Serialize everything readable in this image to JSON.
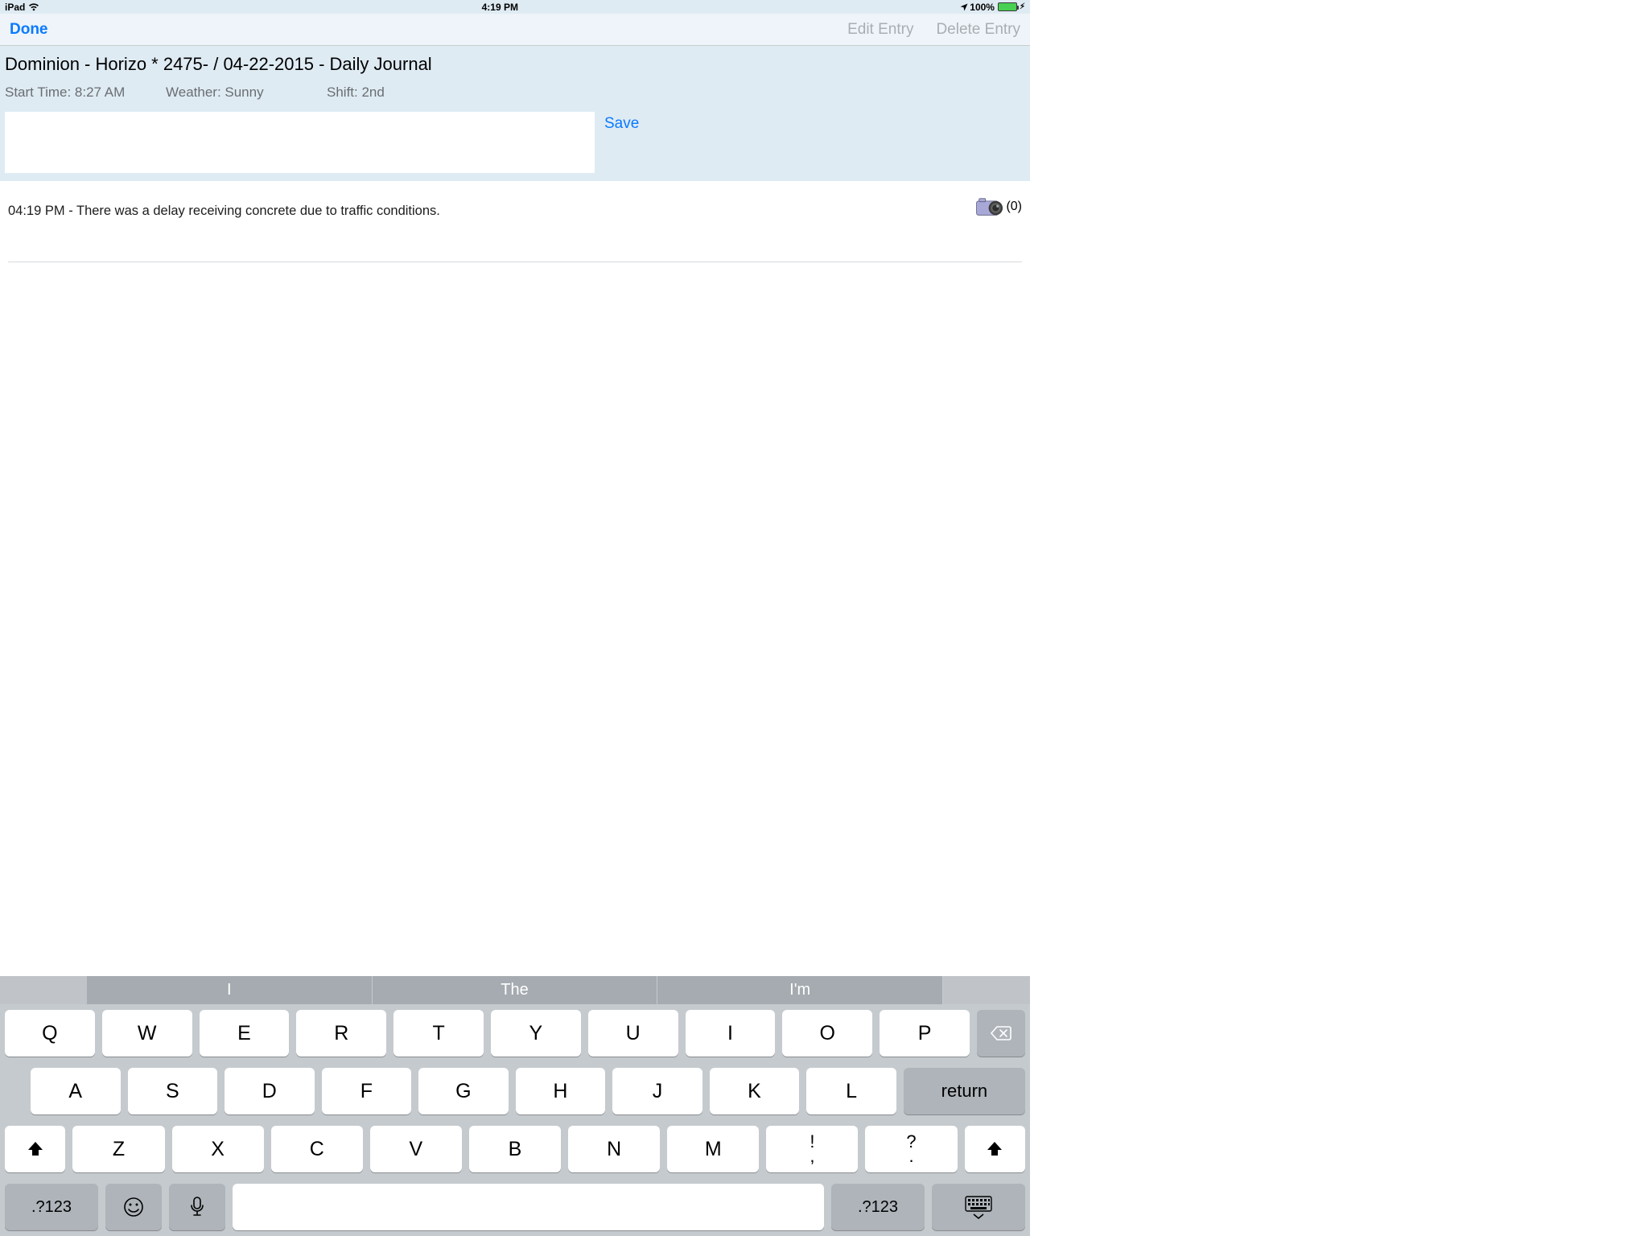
{
  "status": {
    "device": "iPad",
    "time": "4:19 PM",
    "battery_pct": "100%"
  },
  "nav": {
    "done": "Done",
    "edit": "Edit Entry",
    "delete": "Delete Entry"
  },
  "header": {
    "title": "Dominion - Horizo *   2475- / 04-22-2015 - Daily Journal",
    "meta": {
      "start": "Start Time: 8:27 AM",
      "weather": "Weather: Sunny",
      "shift": "Shift: 2nd"
    },
    "save": "Save"
  },
  "entry": {
    "text": "04:19 PM - There was a delay receiving concrete due to traffic conditions.",
    "photo_count": "(0)"
  },
  "keyboard": {
    "predict": [
      "I",
      "The",
      "I'm"
    ],
    "row1": [
      "Q",
      "W",
      "E",
      "R",
      "T",
      "Y",
      "U",
      "I",
      "O",
      "P"
    ],
    "row2": [
      "A",
      "S",
      "D",
      "F",
      "G",
      "H",
      "J",
      "K",
      "L"
    ],
    "row3": [
      "Z",
      "X",
      "C",
      "V",
      "B",
      "N",
      "M"
    ],
    "dual1": {
      "top": "!",
      "bot": ","
    },
    "dual2": {
      "top": "?",
      "bot": "."
    },
    "return": "return",
    "sym": ".?123"
  }
}
